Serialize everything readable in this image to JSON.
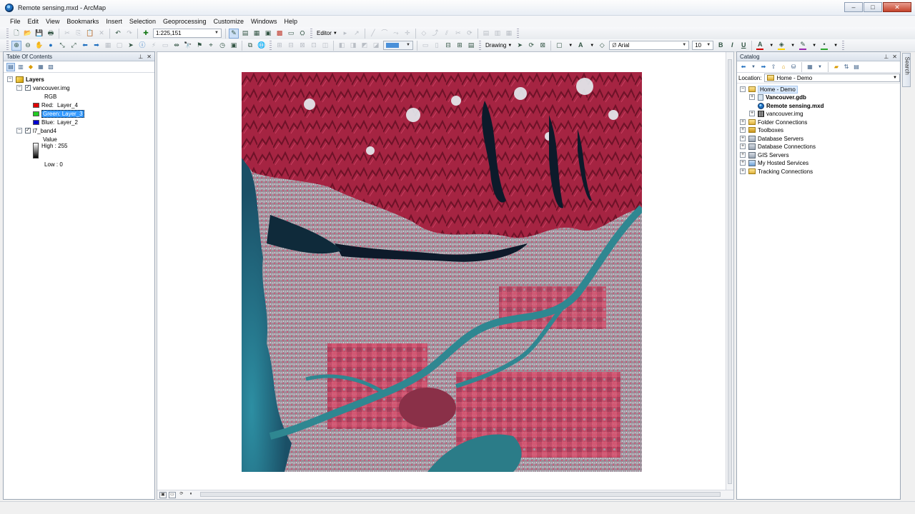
{
  "window": {
    "title": "Remote sensing.mxd - ArcMap"
  },
  "menu": [
    "File",
    "Edit",
    "View",
    "Bookmarks",
    "Insert",
    "Selection",
    "Geoprocessing",
    "Customize",
    "Windows",
    "Help"
  ],
  "toolbar": {
    "scale": "1:225,151",
    "editor_label": "Editor",
    "drawing_label": "Drawing",
    "font_name": "Arial",
    "font_size": "10",
    "bold": "B",
    "italic": "I",
    "underline": "U",
    "text_tool": "A",
    "colors": {
      "font": "#d40000",
      "fill": "#ffd400",
      "line": "#9c27b0",
      "marker": "#2aa82a"
    }
  },
  "toc": {
    "title": "Table Of Contents",
    "root": "Layers",
    "layers": [
      {
        "name": "vancouver.img",
        "checked": true,
        "renderer": "RGB",
        "bands": [
          {
            "label": "Red:",
            "band": "Layer_4",
            "color": "#e00000"
          },
          {
            "label": "Green:",
            "band": "Layer_3",
            "color": "#22cc22",
            "selected": true
          },
          {
            "label": "Blue:",
            "band": "Layer_2",
            "color": "#0000d0"
          }
        ]
      },
      {
        "name": "l7_band4",
        "checked": true,
        "renderer": "Value",
        "high": "High : 255",
        "low": "Low : 0"
      }
    ]
  },
  "catalog": {
    "title": "Catalog",
    "location_label": "Location:",
    "location_value": "Home - Demo",
    "tree": [
      {
        "label": "Home - Demo",
        "level": 0,
        "icon": "folder-icon",
        "expanded": true
      },
      {
        "label": "Vancouver.gdb",
        "level": 1,
        "icon": "geodatabase-icon",
        "bold": true
      },
      {
        "label": "Remote sensing.mxd",
        "level": 1,
        "icon": "map-document-icon",
        "bold": true
      },
      {
        "label": "vancouver.img",
        "level": 1,
        "icon": "raster-icon"
      },
      {
        "label": "Folder Connections",
        "level": 0,
        "icon": "folder-icon"
      },
      {
        "label": "Toolboxes",
        "level": 0,
        "icon": "toolbox-icon"
      },
      {
        "label": "Database Servers",
        "level": 0,
        "icon": "database-server-icon"
      },
      {
        "label": "Database Connections",
        "level": 0,
        "icon": "database-connection-icon"
      },
      {
        "label": "GIS Servers",
        "level": 0,
        "icon": "gis-server-icon"
      },
      {
        "label": "My Hosted Services",
        "level": 0,
        "icon": "hosted-services-icon"
      },
      {
        "label": "Tracking Connections",
        "level": 0,
        "icon": "tracking-icon"
      }
    ]
  },
  "side_tab": "Search"
}
